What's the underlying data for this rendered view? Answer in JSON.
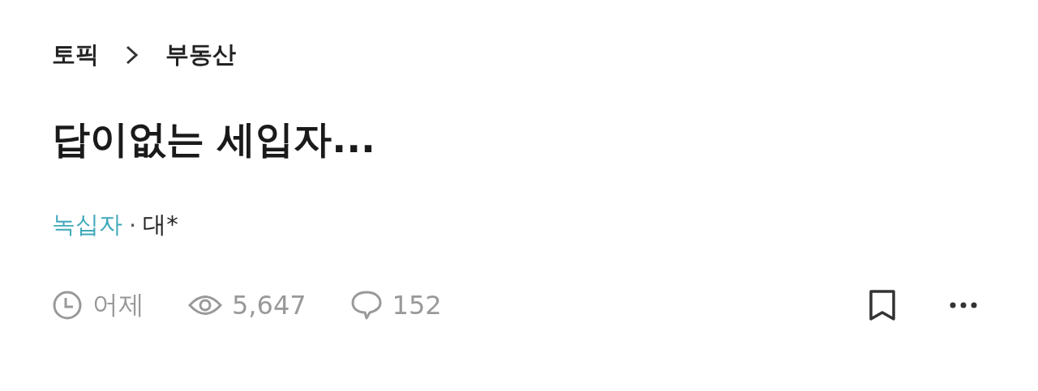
{
  "breadcrumb": [
    "토픽",
    "부동산"
  ],
  "title": "답이없는 세입자...",
  "author": {
    "company": "녹십자",
    "separator": "·",
    "name": "대*"
  },
  "stats": {
    "time": "어제",
    "views": "5,647",
    "comments": "152"
  }
}
